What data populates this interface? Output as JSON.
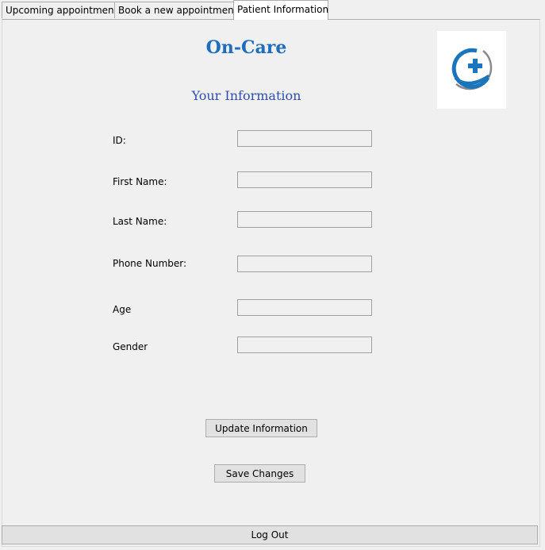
{
  "tabs": [
    {
      "label": "Upcoming appointment"
    },
    {
      "label": "Book a new appointment"
    },
    {
      "label": "Patient Information",
      "active": true
    }
  ],
  "header": {
    "app_title": "On-Care",
    "section_title": "Your Information",
    "logo_icon": "hand-cross-medical-logo-icon"
  },
  "form": {
    "fields": [
      {
        "label": "ID:",
        "value": ""
      },
      {
        "label": "First Name:",
        "value": ""
      },
      {
        "label": "Last Name:",
        "value": ""
      },
      {
        "label": "Phone Number:",
        "value": ""
      },
      {
        "label": "Age",
        "value": ""
      },
      {
        "label": "Gender",
        "value": ""
      }
    ]
  },
  "buttons": {
    "update": "Update Information",
    "save": "Save Changes",
    "logout": "Log Out"
  },
  "colors": {
    "title": "#1f6dbf",
    "section_title": "#2f4fb0",
    "logo_blue": "#1a75bc",
    "logo_grey": "#8a8a8a"
  }
}
